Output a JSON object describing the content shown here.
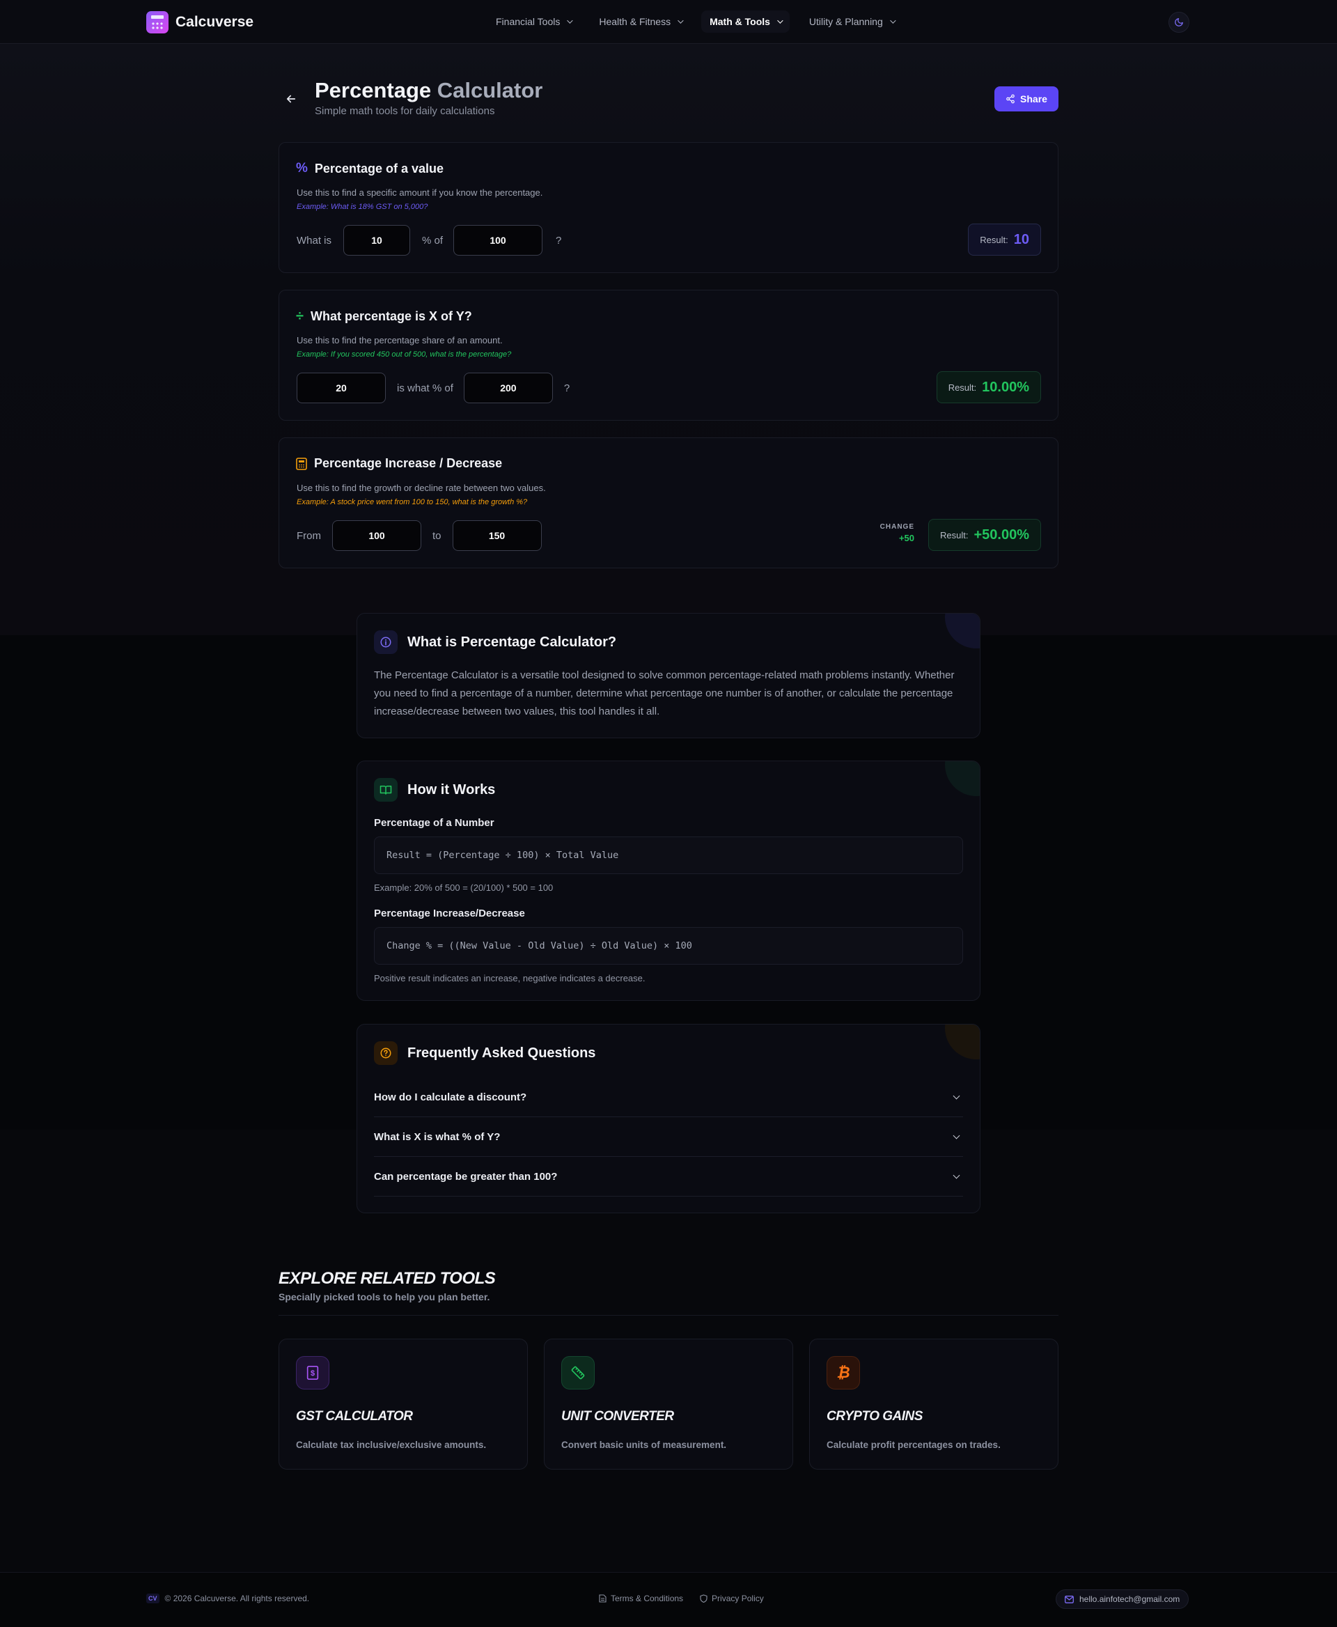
{
  "app": {
    "name": "Calcuverse"
  },
  "nav": [
    {
      "label": "Financial Tools"
    },
    {
      "label": "Health & Fitness"
    },
    {
      "label": "Math & Tools"
    },
    {
      "label": "Utility & Planning"
    }
  ],
  "page": {
    "title_main": "Percentage",
    "title_dim": "Calculator",
    "subtitle": "Simple math tools for daily calculations",
    "share_label": "Share"
  },
  "calc_percent_of": {
    "title": "Percentage of a value",
    "desc": "Use this to find a specific amount if you know the percentage.",
    "example": "Example: What is 18% GST on 5,000?",
    "prefix": "What is",
    "percent_value": "10",
    "mid_label": "% of",
    "total_value": "100",
    "suffix": "?",
    "result_label": "Result:",
    "result_value": "10",
    "accent": "#6d5cf6"
  },
  "calc_what_percent": {
    "title": "What percentage is X of Y?",
    "desc": "Use this to find the percentage share of an amount.",
    "example": "Example: If you scored 450 out of 500, what is the percentage?",
    "x_value": "20",
    "mid_label": "is what % of",
    "y_value": "200",
    "suffix": "?",
    "result_label": "Result:",
    "result_value": "10.00%",
    "accent": "#22c55e"
  },
  "calc_change": {
    "title": "Percentage Increase / Decrease",
    "desc": "Use this to find the growth or decline rate between two values.",
    "example": "Example: A stock price went from 100 to 150, what is the growth %?",
    "from_label": "From",
    "from_value": "100",
    "to_label": "to",
    "to_value": "150",
    "change_label": "CHANGE",
    "change_value": "+50",
    "result_label": "Result:",
    "result_value": "+50.00%",
    "accent": "#f59e0b"
  },
  "about": {
    "title": "What is Percentage Calculator?",
    "body": "The Percentage Calculator is a versatile tool designed to solve common percentage-related math problems instantly. Whether you need to find a percentage of a number, determine what percentage one number is of another, or calculate the percentage increase/decrease between two values, this tool handles it all."
  },
  "how": {
    "title": "How it Works",
    "sec1_title": "Percentage of a Number",
    "sec1_formula": "Result = (Percentage ÷ 100) × Total Value",
    "sec1_note": "Example: 20% of 500 = (20/100) * 500 = 100",
    "sec2_title": "Percentage Increase/Decrease",
    "sec2_formula": "Change % = ((New Value - Old Value) ÷ Old Value) × 100",
    "sec2_note": "Positive result indicates an increase, negative indicates a decrease."
  },
  "faq": {
    "title": "Frequently Asked Questions",
    "items": [
      {
        "q": "How do I calculate a discount?"
      },
      {
        "q": "What is X is what % of Y?"
      },
      {
        "q": "Can percentage be greater than 100?"
      }
    ]
  },
  "related": {
    "title": "EXPLORE RELATED TOOLS",
    "subtitle": "Specially picked tools to help you plan better.",
    "tools": [
      {
        "name": "GST CALCULATOR",
        "desc": "Calculate tax inclusive/exclusive amounts.",
        "icon": "dollar-receipt-icon",
        "color": "#a855f7"
      },
      {
        "name": "UNIT CONVERTER",
        "desc": "Convert basic units of measurement.",
        "icon": "ruler-icon",
        "color": "#22c55e"
      },
      {
        "name": "CRYPTO GAINS",
        "desc": "Calculate profit percentages on trades.",
        "icon": "bitcoin-icon",
        "color": "#f97316"
      }
    ]
  },
  "footer": {
    "badge": "CV",
    "copyright": "© 2026 Calcuverse. All rights reserved.",
    "terms": "Terms & Conditions",
    "privacy": "Privacy Policy",
    "email": "hello.ainfotech@gmail.com"
  }
}
